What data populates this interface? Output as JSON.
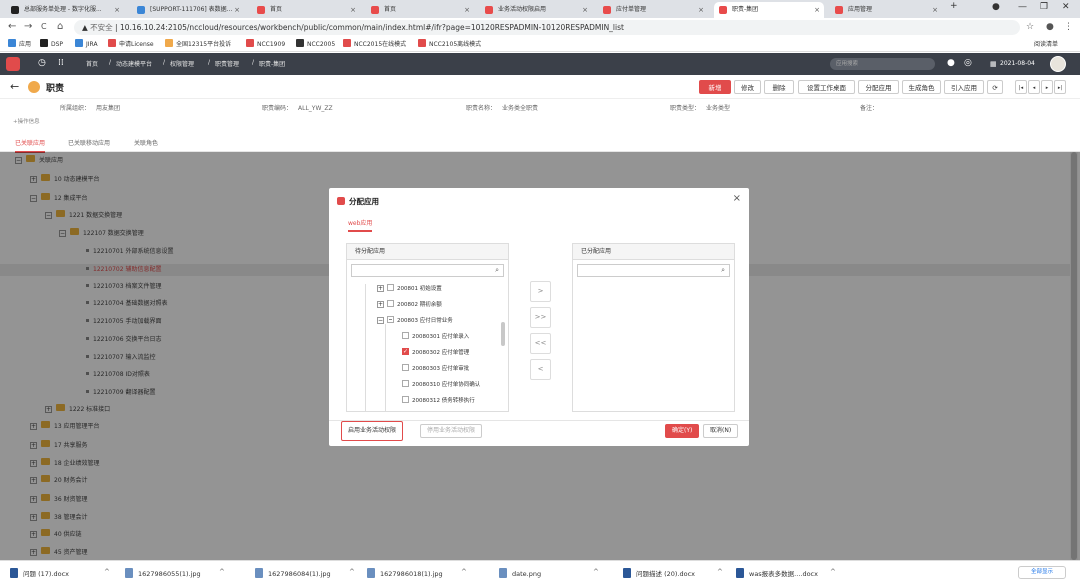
{
  "browser": {
    "tabs": [
      {
        "label": "总部服务单处理 - 数字化服...",
        "color": "#222"
      },
      {
        "label": "[SUPPORT-111706] 表数据...",
        "color": "#3b86d6"
      },
      {
        "label": "首页",
        "color": "#e84b4b"
      },
      {
        "label": "首页",
        "color": "#e84b4b"
      },
      {
        "label": "业务活动权限启用",
        "color": "#e84b4b"
      },
      {
        "label": "应付单管理",
        "color": "#e84b4b"
      },
      {
        "label": "职责-集团",
        "color": "#e84b4b"
      },
      {
        "label": "应用管理",
        "color": "#e84b4b"
      }
    ],
    "new_tab": "+",
    "nav": {
      "back": "←",
      "forward": "→",
      "reload": "C",
      "home": "⌂"
    },
    "url_security": "不安全",
    "url": "10.16.10.24:2105/nccloud/resources/workbench/public/common/main/index.html#/ifr?page=10120RESPADMIN-10120RESPADMIN_list",
    "bookmarks": [
      "应用",
      "DSP",
      "JIRA",
      "申请License",
      "全国12315平台投诉",
      "NCC1909",
      "NCC2005",
      "NCC2015在线模式",
      "NCC2105离线模式"
    ],
    "reading_list": "阅读清单"
  },
  "app": {
    "breadcrumb": [
      "首页",
      "动态建模平台",
      "权限管理",
      "职责管理",
      "职责-集团"
    ],
    "search_placeholder": "应用搜索",
    "date": "2021-08-04",
    "page_title": "职责",
    "toolbar": [
      "新增",
      "修改",
      "删除",
      "设置工作桌面",
      "分配应用",
      "生成角色",
      "引入应用"
    ],
    "info": [
      {
        "label": "所属组织：",
        "value": "用友集团"
      },
      {
        "label": "职责编码：",
        "value": "ALL_YW_ZZ"
      },
      {
        "label": "职责名称：",
        "value": "业务类全职责"
      },
      {
        "label": "职责类型：",
        "value": "业务类型"
      },
      {
        "label": "备注：",
        "value": ""
      }
    ],
    "op_log": "+操作信息",
    "page_tabs": [
      "已关联应用",
      "已关联移动应用",
      "关联角色"
    ],
    "tree": [
      {
        "text": "关联应用",
        "level": 0,
        "kind": "folder",
        "exp": "−"
      },
      {
        "text": "10 动态建模平台",
        "level": 1,
        "kind": "folder",
        "exp": "+"
      },
      {
        "text": "12 集成平台",
        "level": 1,
        "kind": "folder",
        "exp": "−"
      },
      {
        "text": "1221 数据交换管理",
        "level": 2,
        "kind": "folder",
        "exp": "−"
      },
      {
        "text": "122107 数据交换管理",
        "level": 3,
        "kind": "folder",
        "exp": "−"
      },
      {
        "text": "12210701 外部系统信息设置",
        "level": 4,
        "kind": "leaf"
      },
      {
        "text": "12210702 辅助信息配置",
        "level": 4,
        "kind": "leaf",
        "red": true
      },
      {
        "text": "12210703 档案文件管理",
        "level": 4,
        "kind": "leaf"
      },
      {
        "text": "12210704 基础数据对照表",
        "level": 4,
        "kind": "leaf"
      },
      {
        "text": "12210705 手动加载界面",
        "level": 4,
        "kind": "leaf"
      },
      {
        "text": "12210706 交换平台日志",
        "level": 4,
        "kind": "leaf"
      },
      {
        "text": "12210707 输入流监控",
        "level": 4,
        "kind": "leaf"
      },
      {
        "text": "12210708 ID对照表",
        "level": 4,
        "kind": "leaf"
      },
      {
        "text": "12210709 翻译器配置",
        "level": 4,
        "kind": "leaf"
      },
      {
        "text": "1222 标准接口",
        "level": 2,
        "kind": "folder",
        "exp": "+"
      },
      {
        "text": "13 应用管理平台",
        "level": 1,
        "kind": "folder",
        "exp": "+"
      },
      {
        "text": "17 共享服务",
        "level": 1,
        "kind": "folder",
        "exp": "+"
      },
      {
        "text": "18 企业绩效管理",
        "level": 1,
        "kind": "folder",
        "exp": "+"
      },
      {
        "text": "20 财务会计",
        "level": 1,
        "kind": "folder",
        "exp": "+"
      },
      {
        "text": "36 财资管理",
        "level": 1,
        "kind": "folder",
        "exp": "+"
      },
      {
        "text": "38 管理会计",
        "level": 1,
        "kind": "folder",
        "exp": "+"
      },
      {
        "text": "40 供应链",
        "level": 1,
        "kind": "folder",
        "exp": "+"
      },
      {
        "text": "45 资产管理",
        "level": 1,
        "kind": "folder",
        "exp": "+"
      }
    ]
  },
  "modal": {
    "title": "分配应用",
    "tab": "web应用",
    "left_title": "待分配应用",
    "right_title": "已分配应用",
    "left_tree": [
      {
        "text": "200801 初始设置",
        "kind": "pm",
        "exp": "+",
        "check": "off",
        "indent": 0
      },
      {
        "text": "200802 期初余额",
        "kind": "pm",
        "exp": "+",
        "check": "off",
        "indent": 0
      },
      {
        "text": "200803 应付日常业务",
        "kind": "pm",
        "exp": "−",
        "check": "half",
        "indent": 0
      },
      {
        "text": "20080301 应付单录入",
        "kind": "leaf",
        "check": "off",
        "indent": 1
      },
      {
        "text": "20080302 应付单管理",
        "kind": "leaf",
        "check": "on",
        "indent": 1
      },
      {
        "text": "20080303 应付单审批",
        "kind": "leaf",
        "check": "off",
        "indent": 1
      },
      {
        "text": "20080310 应付单协同确认",
        "kind": "leaf",
        "check": "off",
        "indent": 1
      },
      {
        "text": "20080312 债务转移执行",
        "kind": "leaf",
        "check": "off",
        "indent": 1
      }
    ],
    "transfer_buttons": [
      ">",
      ">>",
      "<<",
      "<"
    ],
    "enable_btn": "启用业务活动权限",
    "disable_btn": "停用业务活动权限",
    "ok_btn": "确定(Y)",
    "cancel_btn": "取消(N)",
    "close": "×"
  },
  "downloads": {
    "items": [
      "问题 (17).docx",
      "1627986055(1).jpg",
      "1627986084(1).jpg",
      "1627986018(1).jpg",
      "date.png",
      "问题描述 (20).docx",
      "was报表多数据....docx"
    ],
    "show_all": "全部显示"
  }
}
